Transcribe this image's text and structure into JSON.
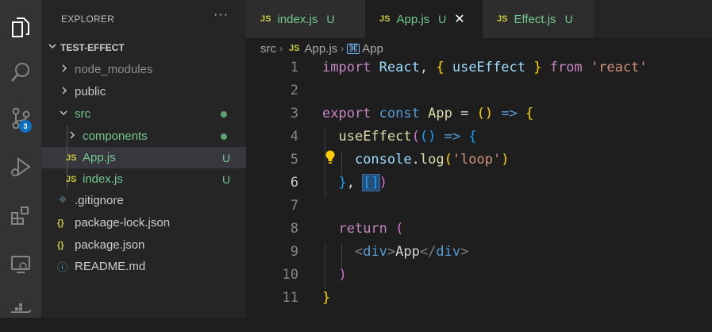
{
  "activity_bar": {
    "icons": [
      "files-icon",
      "search-icon",
      "source-control-icon",
      "run-debug-icon",
      "extensions-icon",
      "remote-explorer-icon",
      "docker-icon"
    ],
    "source_control_badge": "3"
  },
  "sidebar": {
    "title": "EXPLORER",
    "more": "···",
    "project": "TEST-EFFECT",
    "items": [
      {
        "name": "node_modules",
        "status": ""
      },
      {
        "name": "public",
        "status": ""
      },
      {
        "name": "src",
        "status": ""
      },
      {
        "name": "components",
        "status": ""
      },
      {
        "name": "App.js",
        "status": "U",
        "icon": "JS"
      },
      {
        "name": "index.js",
        "status": "U",
        "icon": "JS"
      },
      {
        "name": ".gitignore",
        "status": ""
      },
      {
        "name": "package-lock.json",
        "status": "",
        "icon": "{}"
      },
      {
        "name": "package.json",
        "status": "",
        "icon": "{}"
      },
      {
        "name": "README.md",
        "status": "",
        "icon": "ⓘ"
      }
    ]
  },
  "tabs": [
    {
      "icon": "JS",
      "name": "index.js",
      "status": "U"
    },
    {
      "icon": "JS",
      "name": "App.js",
      "status": "U",
      "close": "✕"
    },
    {
      "icon": "JS",
      "name": "Effect.js",
      "status": "U"
    }
  ],
  "breadcrumbs": {
    "folder": "src",
    "sep": "›",
    "file_icon": "JS",
    "file": "App.js",
    "symbol": "App"
  },
  "editor": {
    "line_numbers": [
      "1",
      "2",
      "3",
      "4",
      "5",
      "6",
      "7",
      "8",
      "9",
      "10",
      "11"
    ],
    "current_line": "6",
    "colors": {
      "keyword": "#c586c0",
      "storage": "#569cd6",
      "function": "#dcdcaa",
      "variable": "#9cdcfe",
      "string": "#ce9178",
      "bracket1": "#ffd700",
      "bracket2": "#da70d6",
      "bracket3": "#179fff"
    },
    "lines": [
      [
        [
          "kw",
          "import"
        ],
        [
          "pun",
          " "
        ],
        [
          "var",
          "React"
        ],
        [
          "pun",
          ", "
        ],
        [
          "b1",
          "{"
        ],
        [
          "pun",
          " "
        ],
        [
          "var",
          "useEffect"
        ],
        [
          "pun",
          " "
        ],
        [
          "b1",
          "}"
        ],
        [
          "pun",
          " "
        ],
        [
          "kw",
          "from"
        ],
        [
          "pun",
          " "
        ],
        [
          "str",
          "'react'"
        ]
      ],
      [],
      [
        [
          "kw",
          "export"
        ],
        [
          "pun",
          " "
        ],
        [
          "kw2",
          "const"
        ],
        [
          "pun",
          " "
        ],
        [
          "fn",
          "App"
        ],
        [
          "pun",
          " "
        ],
        [
          "pun",
          "="
        ],
        [
          "pun",
          " "
        ],
        [
          "b1",
          "()"
        ],
        [
          "pun",
          " "
        ],
        [
          "kw2",
          "=>"
        ],
        [
          "pun",
          " "
        ],
        [
          "b1",
          "{"
        ]
      ],
      [
        [
          "pun",
          "  "
        ],
        [
          "fn",
          "useEffect"
        ],
        [
          "b2",
          "("
        ],
        [
          "b3",
          "()"
        ],
        [
          "pun",
          " "
        ],
        [
          "kw2",
          "=>"
        ],
        [
          "pun",
          " "
        ],
        [
          "b3",
          "{"
        ]
      ],
      [
        [
          "pun",
          "    "
        ],
        [
          "var",
          "console"
        ],
        [
          "pun",
          "."
        ],
        [
          "fn",
          "log"
        ],
        [
          "b1",
          "("
        ],
        [
          "str",
          "'loop'"
        ],
        [
          "b1",
          ")"
        ]
      ],
      [
        [
          "pun",
          "  "
        ],
        [
          "b3",
          "}"
        ],
        [
          "pun",
          ", "
        ],
        [
          "selb3",
          "[]"
        ],
        [
          "b2",
          ")"
        ]
      ],
      [],
      [
        [
          "pun",
          "  "
        ],
        [
          "kw",
          "return"
        ],
        [
          "pun",
          " "
        ],
        [
          "b2",
          "("
        ]
      ],
      [
        [
          "pun",
          "    "
        ],
        [
          "tagb",
          "<"
        ],
        [
          "tag",
          "div"
        ],
        [
          "tagb",
          ">"
        ],
        [
          "pun",
          "App"
        ],
        [
          "tagb",
          "</"
        ],
        [
          "tag",
          "div"
        ],
        [
          "tagb",
          ">"
        ]
      ],
      [
        [
          "pun",
          "  "
        ],
        [
          "b2",
          ")"
        ]
      ],
      [
        [
          "b1",
          "}"
        ]
      ]
    ]
  }
}
